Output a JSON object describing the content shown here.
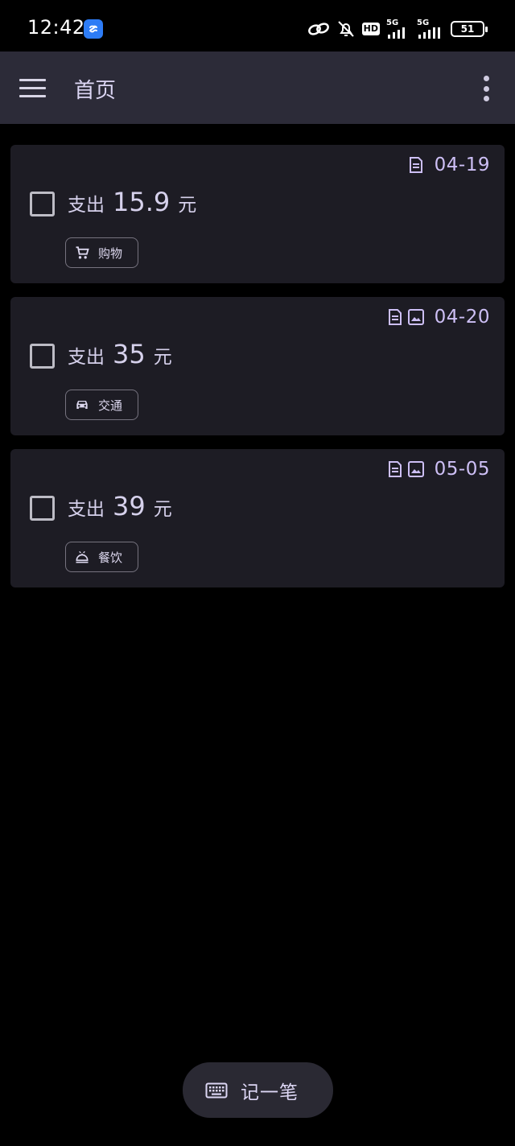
{
  "status_bar": {
    "time": "12:42",
    "network_1": "5G",
    "network_2": "5G",
    "hd": "HD",
    "battery": "51"
  },
  "app_bar": {
    "title": "首页"
  },
  "colors": {
    "accent": "#cdbff5",
    "card_bg": "#1d1c24",
    "app_bar_bg": "#2c2b38",
    "page_bg": "#000000"
  },
  "entries": [
    {
      "date": "04-19",
      "has_note": true,
      "has_image": false,
      "prefix": "支出",
      "amount": "15.9",
      "unit": "元",
      "category": "购物",
      "category_icon": "cart-icon",
      "checked": false
    },
    {
      "date": "04-20",
      "has_note": true,
      "has_image": true,
      "prefix": "支出",
      "amount": "35",
      "unit": "元",
      "category": "交通",
      "category_icon": "car-icon",
      "checked": false
    },
    {
      "date": "05-05",
      "has_note": true,
      "has_image": true,
      "prefix": "支出",
      "amount": "39",
      "unit": "元",
      "category": "餐饮",
      "category_icon": "dining-icon",
      "checked": false
    }
  ],
  "fab": {
    "label": "记一笔",
    "icon": "keyboard-icon"
  }
}
